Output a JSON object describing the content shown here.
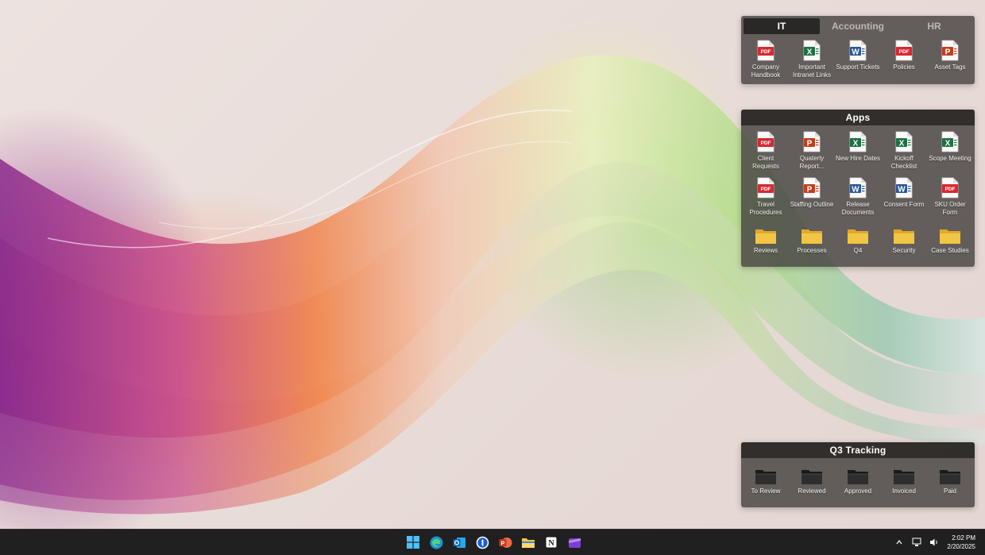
{
  "it_fence": {
    "tabs": [
      {
        "label": "IT",
        "active": true
      },
      {
        "label": "Accounting",
        "active": false
      },
      {
        "label": "HR",
        "active": false
      }
    ],
    "items": [
      {
        "label": "Company Handbook",
        "type": "pdf"
      },
      {
        "label": "Important Intranet Links",
        "type": "excel"
      },
      {
        "label": "Support Tickets",
        "type": "word"
      },
      {
        "label": "Policies",
        "type": "pdf"
      },
      {
        "label": "Asset Tags",
        "type": "powerpoint"
      }
    ]
  },
  "apps_fence": {
    "title": "Apps",
    "items": [
      {
        "label": "Client Requests",
        "type": "pdf"
      },
      {
        "label": "Quaterly Report...",
        "type": "powerpoint"
      },
      {
        "label": "New Hire Dates",
        "type": "excel"
      },
      {
        "label": "Kickoff Checklist",
        "type": "excel"
      },
      {
        "label": "Scope Meeting",
        "type": "excel"
      },
      {
        "label": "Travel Procedures",
        "type": "pdf"
      },
      {
        "label": "Staffing Outline",
        "type": "powerpoint"
      },
      {
        "label": "Release Documents",
        "type": "word"
      },
      {
        "label": "Consent Form",
        "type": "word"
      },
      {
        "label": "SKU Order Form",
        "type": "pdf"
      },
      {
        "label": "Reviews",
        "type": "folder"
      },
      {
        "label": "Processes",
        "type": "folder"
      },
      {
        "label": "Q4",
        "type": "folder"
      },
      {
        "label": "Security",
        "type": "folder"
      },
      {
        "label": "Case Studies",
        "type": "folder"
      }
    ]
  },
  "q3_fence": {
    "title": "Q3 Tracking",
    "items": [
      {
        "label": "To Review",
        "type": "dark-folder"
      },
      {
        "label": "Reviewed",
        "type": "dark-folder"
      },
      {
        "label": "Approved",
        "type": "dark-folder"
      },
      {
        "label": "Invoiced",
        "type": "dark-folder"
      },
      {
        "label": "Paid",
        "type": "dark-folder"
      }
    ]
  },
  "icon_text": {
    "pdf": "PDF",
    "excel": "X",
    "word": "W",
    "powerpoint": "P"
  },
  "taskbar": {
    "apps": [
      "windows-start-icon",
      "edge-browser-icon",
      "outlook-icon",
      "password-manager-icon",
      "powerpoint-icon",
      "file-explorer-icon",
      "notion-icon",
      "clipchamp-icon"
    ]
  },
  "tray": {
    "time": "2:02 PM",
    "date": "2/20/2025"
  },
  "colors": {
    "pdf": "#d9282f",
    "excel": "#1e7145",
    "word": "#2b579a",
    "powerpoint": "#c43e1c",
    "folder": "#f3c545",
    "fence_bg": "#464240",
    "taskbar": "#202020"
  }
}
